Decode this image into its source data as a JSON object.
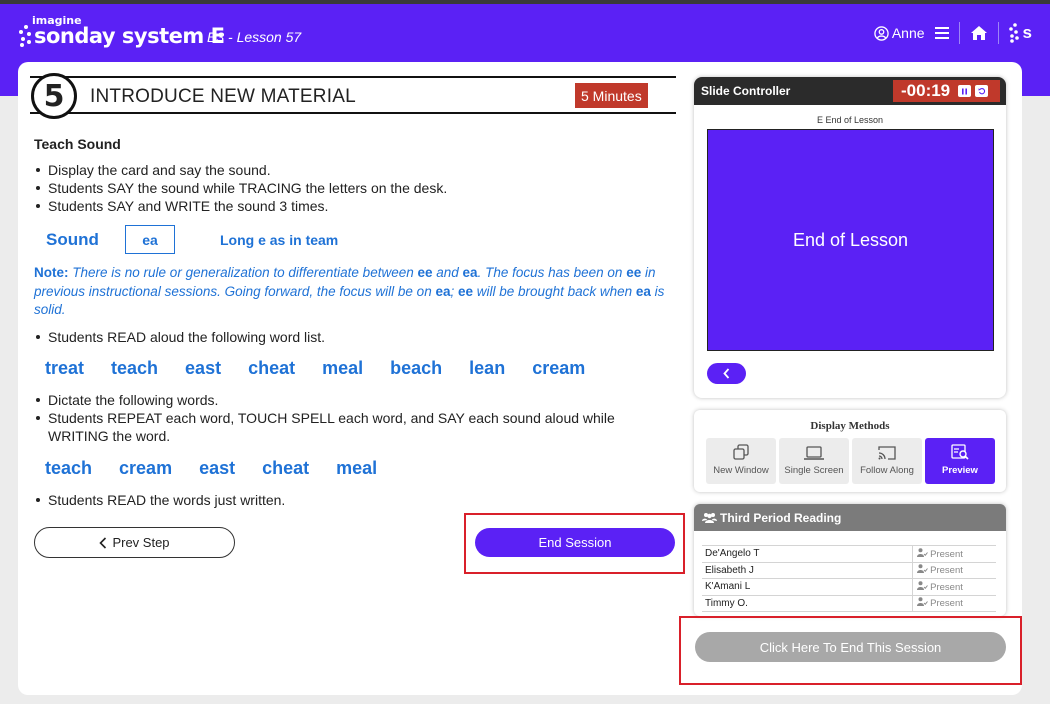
{
  "header": {
    "logo_top": "imagine",
    "logo_brand": "sonday system E",
    "lesson_title": "E3 - Lesson 57",
    "user_name": "Anne"
  },
  "step": {
    "number": "5",
    "title": "INTRODUCE NEW MATERIAL",
    "duration": "5 Minutes"
  },
  "teach": {
    "title": "Teach Sound",
    "bullets_1": [
      "Display the card and say the sound.",
      "Students SAY the sound while TRACING the letters on the desk.",
      "Students SAY and WRITE the sound 3 times."
    ],
    "sound_label": "Sound",
    "sound_value": "ea",
    "sound_desc": "Long e as in team",
    "note_label": "Note:",
    "note_parts": [
      "There is no rule or generalization to differentiate between ",
      "ee",
      " and ",
      "ea",
      ". The focus has been on ",
      "ee",
      " in previous instructional sessions. Going forward, the focus will be on ",
      "ea",
      "; ",
      "ee",
      " will be brought back when ",
      "ea",
      " is solid."
    ],
    "bullets_2": [
      "Students READ aloud the following word list."
    ],
    "word_list": [
      "treat",
      "teach",
      "east",
      "cheat",
      "meal",
      "beach",
      "lean",
      "cream"
    ],
    "bullets_3": [
      "Dictate the following words.",
      "Students REPEAT each word, TOUCH SPELL each word, and SAY each sound aloud while WRITING the word."
    ],
    "dictation_words": [
      "teach",
      "cream",
      "east",
      "cheat",
      "meal"
    ],
    "bullets_4": [
      "Students READ the words just written."
    ]
  },
  "nav": {
    "prev_label": "Prev Step",
    "end_session_label": "End Session"
  },
  "slide_controller": {
    "title": "Slide Controller",
    "timer": "-00:19",
    "slide_caption": "E End of Lesson",
    "slide_text": "End of Lesson"
  },
  "display_methods": {
    "title": "Display Methods",
    "options": [
      "New Window",
      "Single Screen",
      "Follow Along",
      "Preview"
    ],
    "active": "Preview"
  },
  "roster": {
    "title": "Third Period Reading",
    "students": [
      {
        "name": "De'Angelo T",
        "status": "Present"
      },
      {
        "name": "Elisabeth J",
        "status": "Present"
      },
      {
        "name": "K'Amani L",
        "status": "Present"
      },
      {
        "name": "Timmy O.",
        "status": "Present"
      }
    ]
  },
  "end_this_session_label": "Click Here To End This Session",
  "colors": {
    "brand_purple": "#5b21f5",
    "link_blue": "#1f72d6",
    "timer_red": "#c0392b",
    "highlight_red": "#d9202a"
  }
}
